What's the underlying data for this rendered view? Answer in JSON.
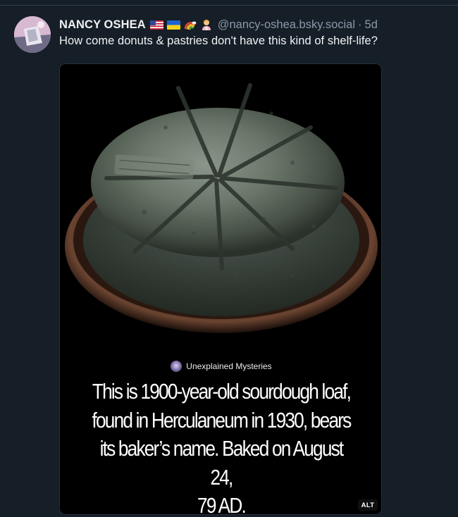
{
  "post": {
    "author": {
      "display_name": "NANCY OSHEA",
      "handle": "@nancy-oshea.bsky.social",
      "time_separator": "·",
      "timestamp": "5d",
      "flag_icons": [
        "us-flag-icon",
        "ukraine-flag-icon",
        "rainbow-icon",
        "person-icon"
      ]
    },
    "text": "How come donuts & pastries don't have this kind of shelf-life?",
    "media": {
      "source_name": "Unexplained Mysteries",
      "caption_lines": [
        "This is 1900-year-old sourdough loaf,",
        "found in Herculaneum in 1930, bears",
        "its baker’s name. Baked on August 24,",
        "79 AD."
      ],
      "alt_badge": "ALT"
    }
  },
  "colors": {
    "background": "#161e27",
    "text_primary": "#f1f3f5",
    "text_secondary": "#8b98a9"
  }
}
